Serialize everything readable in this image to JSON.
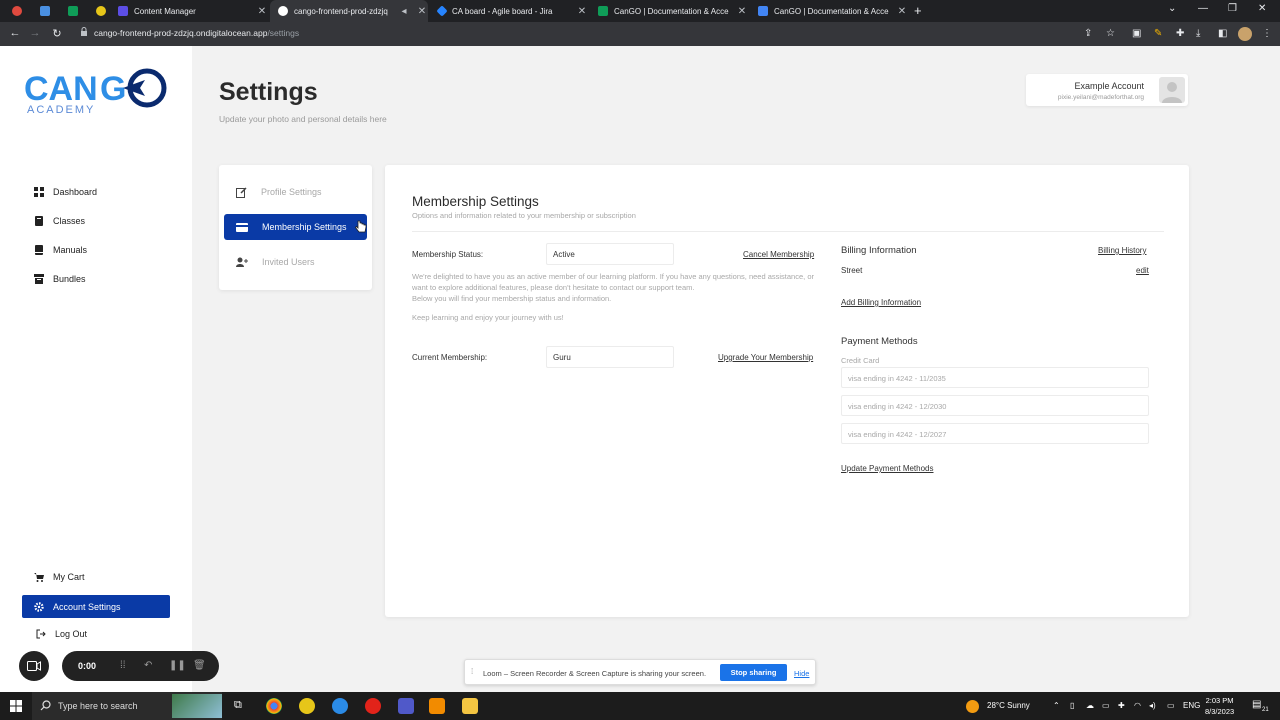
{
  "browser": {
    "tabs": [
      {
        "title": "Content Manager",
        "color": "#5c4ee5"
      },
      {
        "title": "cango-frontend-prod-zdzjq",
        "color": "#ffffff"
      },
      {
        "title": "CA board - Agile board - Jira",
        "color": "#2684ff"
      },
      {
        "title": "CanGO | Documentation & Acce",
        "color": "#0f9d58"
      },
      {
        "title": "CanGO | Documentation & Acce",
        "color": "#4285f4"
      }
    ],
    "url_host": "cango-frontend-prod-zdzjq.ondigitalocean.app",
    "url_path": "/settings"
  },
  "brand": {
    "accent": "#0a3aa6",
    "logo_top": "CANGO",
    "logo_bottom": "ACADEMY"
  },
  "sidebar": {
    "items": [
      {
        "label": "Dashboard",
        "icon": "grid-icon"
      },
      {
        "label": "Classes",
        "icon": "layers-icon"
      },
      {
        "label": "Manuals",
        "icon": "book-icon"
      },
      {
        "label": "Bundles",
        "icon": "bundle-icon"
      }
    ],
    "bottom": [
      {
        "label": "My Cart",
        "icon": "cart-icon"
      },
      {
        "label": "Account Settings",
        "icon": "gear-icon"
      },
      {
        "label": "Log Out",
        "icon": "logout-icon"
      }
    ]
  },
  "header": {
    "title": "Settings",
    "subtitle": "Update your photo and personal details here"
  },
  "account": {
    "name": "Example Account",
    "email": "pixie.yeilani@madeforthat.org"
  },
  "settings_menu": {
    "items": [
      {
        "label": "Profile Settings"
      },
      {
        "label": "Membership Settings"
      },
      {
        "label": "Invited Users"
      }
    ]
  },
  "membership": {
    "title": "Membership Settings",
    "subtitle": "Options and information related to your membership or subscription",
    "status_label": "Membership Status:",
    "status_value": "Active",
    "cancel_link": "Cancel Membership",
    "paragraph1": "We're delighted to have you as an active member of our learning platform. If you have any questions, need assistance, or want to explore additional features, please don't hesitate to contact our support team.",
    "paragraph2": "Below you will find your membership status and information.",
    "paragraph3": "Keep learning and enjoy your journey with us!",
    "current_label": "Current Membership:",
    "current_value": "Guru",
    "upgrade_link": "Upgrade Your Membership"
  },
  "billing": {
    "title": "Billing Information",
    "history_link": "Billing History",
    "street_label": "Street",
    "edit_link": "edit",
    "add_link": "Add Billing Information"
  },
  "payment": {
    "title": "Payment Methods",
    "card_label": "Credit Card",
    "cards": [
      "visa ending in 4242 - 11/2035",
      "visa ending in 4242 - 12/2030",
      "visa ending in 4242 - 12/2027"
    ],
    "update_link": "Update Payment Methods"
  },
  "loom": {
    "timer": "0:00",
    "share_text": "Loom – Screen Recorder & Screen Capture is sharing your screen.",
    "stop_label": "Stop sharing",
    "hide_label": "Hide"
  },
  "taskbar": {
    "search_placeholder": "Type here to search",
    "weather": "28°C  Sunny",
    "language": "ENG",
    "time": "2:03 PM",
    "date": "8/3/2023",
    "notif_count": "21"
  }
}
